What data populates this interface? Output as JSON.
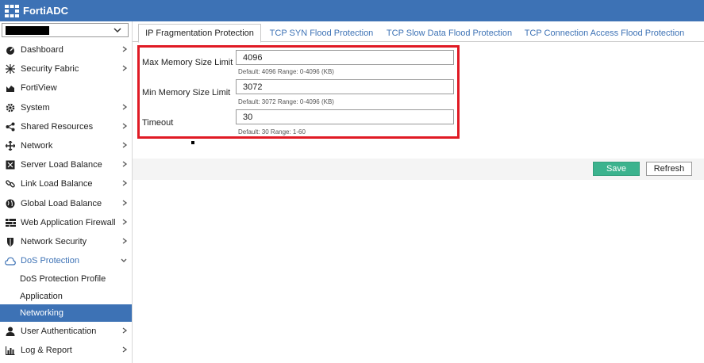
{
  "app": {
    "title": "FortiADC"
  },
  "sidebar": {
    "vdom_select": {
      "value": ""
    },
    "items": [
      {
        "key": "dashboard",
        "label": "Dashboard",
        "icon": "dashboard-icon"
      },
      {
        "key": "security-fabric",
        "label": "Security Fabric",
        "icon": "fabric-icon"
      },
      {
        "key": "fortiview",
        "label": "FortiView",
        "icon": "chart-icon"
      },
      {
        "key": "system",
        "label": "System",
        "icon": "gear-icon"
      },
      {
        "key": "shared-resources",
        "label": "Shared Resources",
        "icon": "share-icon"
      },
      {
        "key": "network",
        "label": "Network",
        "icon": "network-icon"
      },
      {
        "key": "server-load-balance",
        "label": "Server Load Balance",
        "icon": "server-icon"
      },
      {
        "key": "link-load-balance",
        "label": "Link Load Balance",
        "icon": "link-icon"
      },
      {
        "key": "global-load-balance",
        "label": "Global Load Balance",
        "icon": "globe-icon"
      },
      {
        "key": "waf",
        "label": "Web Application Firewall",
        "icon": "firewall-icon"
      },
      {
        "key": "network-security",
        "label": "Network Security",
        "icon": "shield-icon"
      },
      {
        "key": "dos-protection",
        "label": "DoS Protection",
        "icon": "cloud-icon"
      }
    ],
    "dos_sub_items": [
      {
        "label": "DoS Protection Profile"
      },
      {
        "label": "Application"
      },
      {
        "label": "Networking"
      }
    ],
    "bottom_items": [
      {
        "key": "user-authentication",
        "label": "User Authentication",
        "icon": "user-icon"
      },
      {
        "key": "log-report",
        "label": "Log & Report",
        "icon": "report-icon"
      }
    ]
  },
  "tabs": [
    {
      "label": "IP Fragmentation Protection"
    },
    {
      "label": "TCP SYN Flood Protection"
    },
    {
      "label": "TCP Slow Data Flood Protection"
    },
    {
      "label": "TCP Connection Access Flood Protection"
    }
  ],
  "form": {
    "max_mem": {
      "label": "Max Memory Size Limit",
      "value": "4096",
      "hint": "Default: 4096 Range: 0-4096 (KB)"
    },
    "min_mem": {
      "label": "Min Memory Size Limit",
      "value": "3072",
      "hint": "Default: 3072 Range: 0-4096 (KB)"
    },
    "timeout": {
      "label": "Timeout",
      "value": "30",
      "hint": "Default: 30 Range: 1-60"
    }
  },
  "actions": {
    "save": "Save",
    "refresh": "Refresh"
  },
  "colors": {
    "brand": "#3d72b5",
    "save": "#3cb38e",
    "highlight": "#e01a24"
  }
}
